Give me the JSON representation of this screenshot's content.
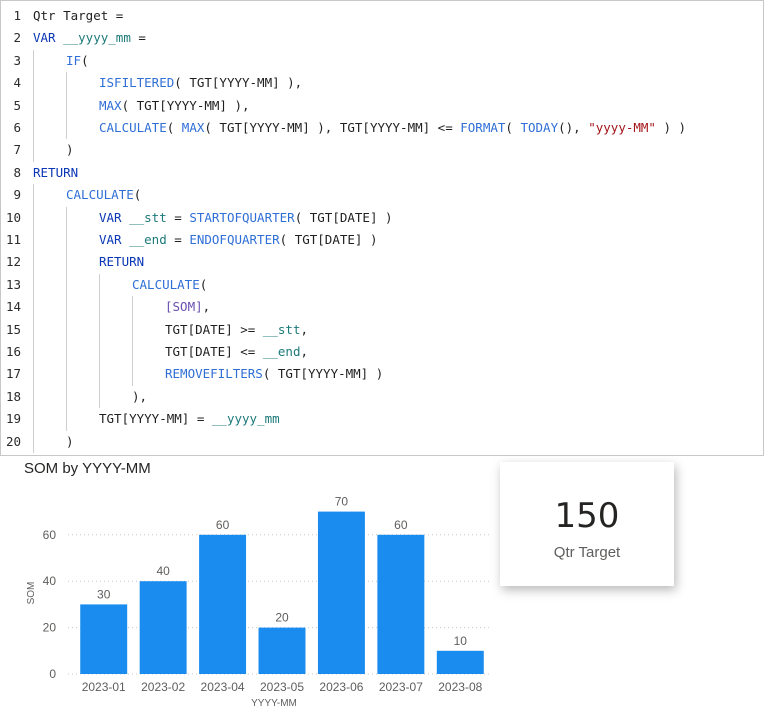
{
  "editor": {
    "lines": [
      {
        "n": "1",
        "indent": 0,
        "tokens": [
          {
            "c": "plain",
            "t": "Qtr Target ="
          }
        ]
      },
      {
        "n": "2",
        "indent": 0,
        "tokens": [
          {
            "c": "kw",
            "t": "VAR "
          },
          {
            "c": "var",
            "t": "__yyyy_mm"
          },
          {
            "c": "plain",
            "t": " ="
          }
        ]
      },
      {
        "n": "3",
        "indent": 1,
        "tokens": [
          {
            "c": "fn",
            "t": "IF"
          },
          {
            "c": "plain",
            "t": "("
          }
        ]
      },
      {
        "n": "4",
        "indent": 2,
        "tokens": [
          {
            "c": "fn",
            "t": "ISFILTERED"
          },
          {
            "c": "plain",
            "t": "( TGT[YYYY-MM] ),"
          }
        ]
      },
      {
        "n": "5",
        "indent": 2,
        "tokens": [
          {
            "c": "fn",
            "t": "MAX"
          },
          {
            "c": "plain",
            "t": "( TGT[YYYY-MM] ),"
          }
        ]
      },
      {
        "n": "6",
        "indent": 2,
        "tokens": [
          {
            "c": "fn",
            "t": "CALCULATE"
          },
          {
            "c": "plain",
            "t": "( "
          },
          {
            "c": "fn",
            "t": "MAX"
          },
          {
            "c": "plain",
            "t": "( TGT[YYYY-MM] ), TGT[YYYY-MM] <= "
          },
          {
            "c": "fn",
            "t": "FORMAT"
          },
          {
            "c": "plain",
            "t": "( "
          },
          {
            "c": "fn",
            "t": "TODAY"
          },
          {
            "c": "plain",
            "t": "(), "
          },
          {
            "c": "str",
            "t": "\"yyyy-MM\""
          },
          {
            "c": "plain",
            "t": " ) )"
          }
        ]
      },
      {
        "n": "7",
        "indent": 1,
        "tokens": [
          {
            "c": "plain",
            "t": ")"
          }
        ]
      },
      {
        "n": "8",
        "indent": 0,
        "tokens": [
          {
            "c": "kw",
            "t": "RETURN"
          }
        ]
      },
      {
        "n": "9",
        "indent": 1,
        "tokens": [
          {
            "c": "fn",
            "t": "CALCULATE"
          },
          {
            "c": "plain",
            "t": "("
          }
        ]
      },
      {
        "n": "10",
        "indent": 2,
        "tokens": [
          {
            "c": "kw",
            "t": "VAR "
          },
          {
            "c": "var",
            "t": "__stt"
          },
          {
            "c": "plain",
            "t": " = "
          },
          {
            "c": "fn",
            "t": "STARTOFQUARTER"
          },
          {
            "c": "plain",
            "t": "( TGT[DATE] )"
          }
        ]
      },
      {
        "n": "11",
        "indent": 2,
        "tokens": [
          {
            "c": "kw",
            "t": "VAR "
          },
          {
            "c": "var",
            "t": "__end"
          },
          {
            "c": "plain",
            "t": " = "
          },
          {
            "c": "fn",
            "t": "ENDOFQUARTER"
          },
          {
            "c": "plain",
            "t": "( TGT[DATE] )"
          }
        ]
      },
      {
        "n": "12",
        "indent": 2,
        "tokens": [
          {
            "c": "kw",
            "t": "RETURN"
          }
        ]
      },
      {
        "n": "13",
        "indent": 3,
        "tokens": [
          {
            "c": "fn",
            "t": "CALCULATE"
          },
          {
            "c": "plain",
            "t": "("
          }
        ]
      },
      {
        "n": "14",
        "indent": 4,
        "tokens": [
          {
            "c": "meas",
            "t": "[SOM]"
          },
          {
            "c": "plain",
            "t": ","
          }
        ]
      },
      {
        "n": "15",
        "indent": 4,
        "tokens": [
          {
            "c": "plain",
            "t": "TGT[DATE] >= "
          },
          {
            "c": "var",
            "t": "__stt"
          },
          {
            "c": "plain",
            "t": ","
          }
        ]
      },
      {
        "n": "16",
        "indent": 4,
        "tokens": [
          {
            "c": "plain",
            "t": "TGT[DATE] <= "
          },
          {
            "c": "var",
            "t": "__end"
          },
          {
            "c": "plain",
            "t": ","
          }
        ]
      },
      {
        "n": "17",
        "indent": 4,
        "tokens": [
          {
            "c": "fn",
            "t": "REMOVEFILTERS"
          },
          {
            "c": "plain",
            "t": "( TGT[YYYY-MM] )"
          }
        ]
      },
      {
        "n": "18",
        "indent": 3,
        "tokens": [
          {
            "c": "plain",
            "t": "),"
          }
        ]
      },
      {
        "n": "19",
        "indent": 2,
        "tokens": [
          {
            "c": "plain",
            "t": "TGT[YYYY-MM] = "
          },
          {
            "c": "var",
            "t": "__yyyy_mm"
          }
        ]
      },
      {
        "n": "20",
        "indent": 1,
        "tokens": [
          {
            "c": "plain",
            "t": ")"
          }
        ]
      }
    ]
  },
  "chart_data": {
    "type": "bar",
    "title": "SOM by YYYY-MM",
    "xlabel": "YYYY-MM",
    "ylabel": "SOM",
    "categories": [
      "2023-01",
      "2023-02",
      "2023-04",
      "2023-05",
      "2023-06",
      "2023-07",
      "2023-08"
    ],
    "values": [
      30,
      40,
      60,
      20,
      70,
      60,
      10
    ],
    "yticks": [
      0,
      20,
      40,
      60
    ],
    "ylim": [
      0,
      75
    ],
    "grid": true,
    "bar_color": "#1a8cf0"
  },
  "card": {
    "value": "150",
    "label": "Qtr Target"
  }
}
